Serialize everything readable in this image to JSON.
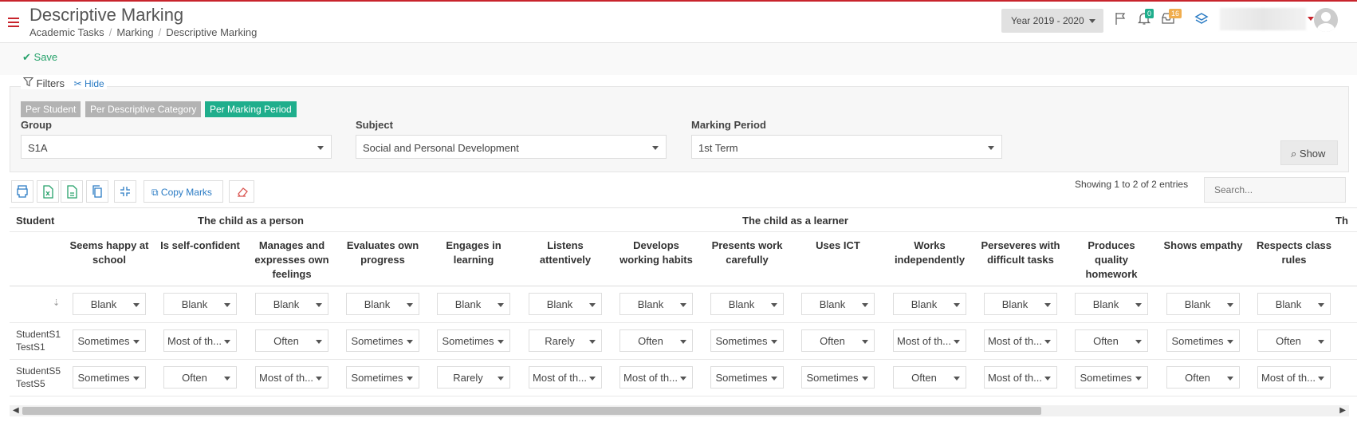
{
  "header": {
    "title": "Descriptive Marking",
    "breadcrumb": [
      "Academic Tasks",
      "Marking",
      "Descriptive Marking"
    ],
    "year_selector": "Year 2019 - 2020",
    "notifications_count": "0",
    "messages_count": "16"
  },
  "toolbar": {
    "save_label": "Save"
  },
  "filters": {
    "legend": "Filters",
    "hide_label": "Hide",
    "modes": [
      "Per Student",
      "Per Descriptive Category",
      "Per Marking Period"
    ],
    "active_mode": "Per Marking Period",
    "group_label": "Group",
    "group_value": "S1A",
    "subject_label": "Subject",
    "subject_value": "Social and Personal Development",
    "period_label": "Marking Period",
    "period_value": "1st Term",
    "show_label": "Show"
  },
  "table_toolbar": {
    "copy_marks_label": "Copy Marks",
    "showing_text": "Showing 1 to 2 of 2 entries",
    "search_placeholder": "Search..."
  },
  "table": {
    "student_header": "Student",
    "group_headers": [
      "The child as a person",
      "The child as a learner",
      "Th"
    ],
    "columns": [
      "Seems happy at school",
      "Is self-confident",
      "Manages and expresses own feelings",
      "Evaluates own progress",
      "Engages in learning",
      "Listens attentively",
      "Develops working habits",
      "Presents work carefully",
      "Uses ICT",
      "Works independently",
      "Perseveres with difficult tasks",
      "Produces quality homework",
      "Shows empathy",
      "Respects class rules"
    ],
    "bulk_values": [
      "Blank",
      "Blank",
      "Blank",
      "Blank",
      "Blank",
      "Blank",
      "Blank",
      "Blank",
      "Blank",
      "Blank",
      "Blank",
      "Blank",
      "Blank",
      "Blank"
    ],
    "rows": [
      {
        "student": [
          "StudentS1",
          "TestS1"
        ],
        "values": [
          "Sometimes",
          "Most of th...",
          "Often",
          "Sometimes",
          "Sometimes",
          "Rarely",
          "Often",
          "Sometimes",
          "Often",
          "Most of th...",
          "Most of th...",
          "Often",
          "Sometimes",
          "Often"
        ]
      },
      {
        "student": [
          "StudentS5",
          "TestS5"
        ],
        "values": [
          "Sometimes",
          "Often",
          "Most of th...",
          "Sometimes",
          "Rarely",
          "Most of th...",
          "Most of th...",
          "Sometimes",
          "Sometimes",
          "Often",
          "Most of th...",
          "Sometimes",
          "Often",
          "Most of th..."
        ]
      }
    ]
  },
  "colors": {
    "accent_red": "#c8242c",
    "save_green": "#27a26b",
    "active_mode": "#1fae8c",
    "inactive_mode": "#b3b3b3",
    "link_blue": "#2a7bc4"
  }
}
